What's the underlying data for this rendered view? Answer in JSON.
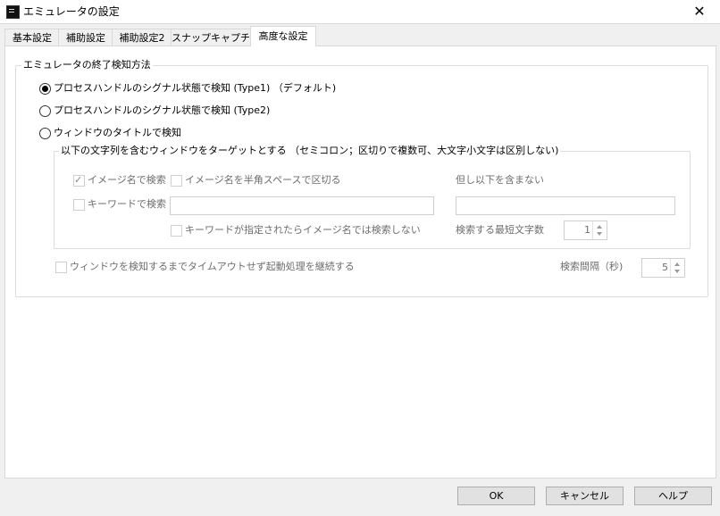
{
  "window": {
    "title": "エミュレータの設定"
  },
  "tabs": [
    {
      "label": "基本設定"
    },
    {
      "label": "補助設定"
    },
    {
      "label": "補助設定2"
    },
    {
      "label": "スナップキャプチャ"
    },
    {
      "label": "高度な設定",
      "active": true
    }
  ],
  "group_main": {
    "legend": "エミュレータの終了検知方法",
    "radios": [
      {
        "label": "プロセスハンドルのシグナル状態で検知 (Type1) （デフォルト)",
        "checked": true
      },
      {
        "label": "プロセスハンドルのシグナル状態で検知 (Type2)",
        "checked": false
      },
      {
        "label": "ウィンドウのタイトルで検知",
        "checked": false
      }
    ]
  },
  "group_window": {
    "legend": "以下の文字列を含むウィンドウをターゲットとする （セミコロン；区切りで複数可、大文字小文字は区別しない)",
    "check_image_name": {
      "label": "イメージ名で検索",
      "checked": true
    },
    "check_split_space": {
      "label": "イメージ名を半角スペースで区切る",
      "checked": false
    },
    "exclude_label": "但し以下を含まない",
    "check_keyword": {
      "label": "キーワードで検索",
      "checked": false
    },
    "keyword_value": "",
    "exclude_value": "",
    "check_no_image_search": {
      "label": "キーワードが指定されたらイメージ名では検索しない",
      "checked": false
    },
    "min_chars_label": "検索する最短文字数",
    "min_chars_value": "1"
  },
  "timeout": {
    "check": {
      "label": "ウィンドウを検知するまでタイムアウトせず起動処理を継続する",
      "checked": false
    },
    "interval_label": "検索間隔（秒)",
    "interval_value": "5"
  },
  "buttons": {
    "ok": "OK",
    "cancel": "キャンセル",
    "help": "ヘルプ"
  }
}
